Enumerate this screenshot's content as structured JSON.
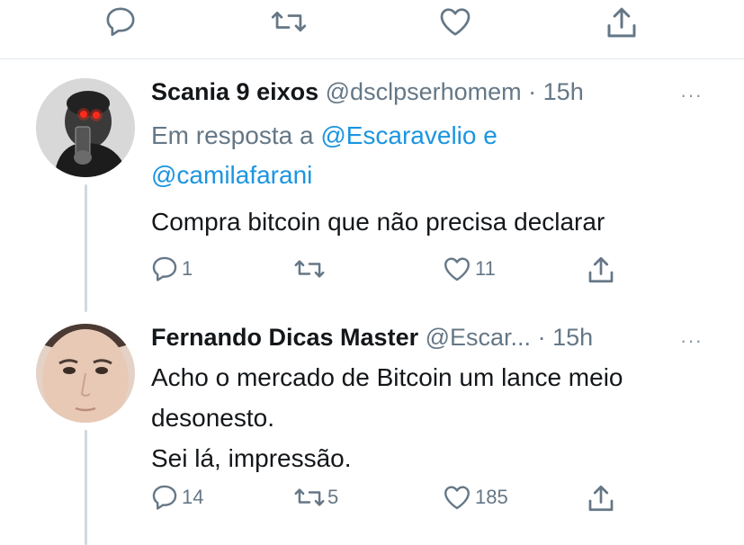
{
  "prev_tweet_actions": {
    "icons": [
      "reply-icon",
      "retweet-icon",
      "like-icon",
      "share-icon"
    ]
  },
  "tweets": [
    {
      "name": "Scania 9 eixos",
      "handle": "@dsclpserhomem",
      "separator": "·",
      "time": "15h",
      "more": "···",
      "reply_prefix": "Em resposta a",
      "reply_user_1": "@Escaravelio",
      "reply_join": "e",
      "reply_user_2": "@camilafarani",
      "text_lines": [
        "Compra bitcoin que não precisa declarar"
      ],
      "reply_count": "1",
      "retweet_count": "",
      "like_count": "11"
    },
    {
      "name": "Fernando Dicas Master",
      "handle": "@Escar...",
      "separator": "·",
      "time": "15h",
      "more": "···",
      "text_lines": [
        "Acho o mercado de Bitcoin um lance meio",
        "desonesto.",
        "Sei lá, impressão."
      ],
      "reply_count": "14",
      "retweet_count": "5",
      "like_count": "185"
    }
  ],
  "colors": {
    "text": "#14171a",
    "secondary": "#657786",
    "link": "#1b95e0",
    "divider": "#e1e8ed",
    "thread_line": "#cfd9de"
  }
}
